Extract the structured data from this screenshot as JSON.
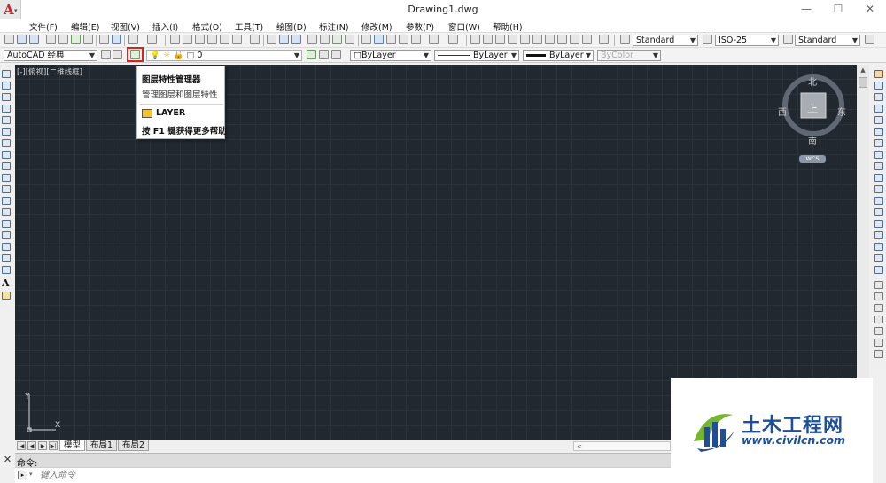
{
  "window": {
    "title": "Drawing1.dwg",
    "controls": {
      "minimize": "—",
      "maximize": "☐",
      "close": "✕"
    }
  },
  "menubar": {
    "items": [
      "文件(F)",
      "编辑(E)",
      "视图(V)",
      "插入(I)",
      "格式(O)",
      "工具(T)",
      "绘图(D)",
      "标注(N)",
      "修改(M)",
      "参数(P)",
      "窗口(W)",
      "帮助(H)"
    ]
  },
  "toolbar_styles": {
    "text_style": "Standard",
    "dim_style": "ISO-25",
    "table_style": "Standard"
  },
  "layers_toolbar": {
    "workspace": "AutoCAD 经典",
    "current_layer": "0",
    "color": "ByLayer",
    "linetype": "ByLayer",
    "lineweight": "ByLayer",
    "plot_style": "ByColor"
  },
  "viewport": {
    "label": "[-][俯视][二维线框]"
  },
  "viewcube": {
    "face": "上",
    "north": "北",
    "south": "南",
    "east": "东",
    "west": "西",
    "wcs": "WCS"
  },
  "ucs": {
    "x": "X",
    "y": "Y"
  },
  "tooltip": {
    "title": "图层特性管理器",
    "description": "管理图层和图层特性",
    "command": "LAYER",
    "help": "按 F1 键获得更多帮助"
  },
  "layout_tabs": [
    "模型",
    "布局1",
    "布局2"
  ],
  "command_line": {
    "history_label": "命令:",
    "placeholder": "键入命令",
    "close": "✕"
  },
  "watermark": {
    "title": "土木工程网",
    "url": "www.civilcn.com"
  },
  "colors": {
    "drawing_background": "#212830",
    "grid": "#2a323c",
    "highlight_box": "#e02020",
    "watermark_blue": "#1d4e97"
  },
  "icons": [
    "app-logo-icon",
    "layer-properties-icon",
    "layer-state-icon",
    "orbit-icon",
    "new-file-icon",
    "open-file-icon",
    "save-icon",
    "print-icon",
    "undo-icon",
    "redo-icon",
    "pan-icon",
    "zoom-icon"
  ]
}
